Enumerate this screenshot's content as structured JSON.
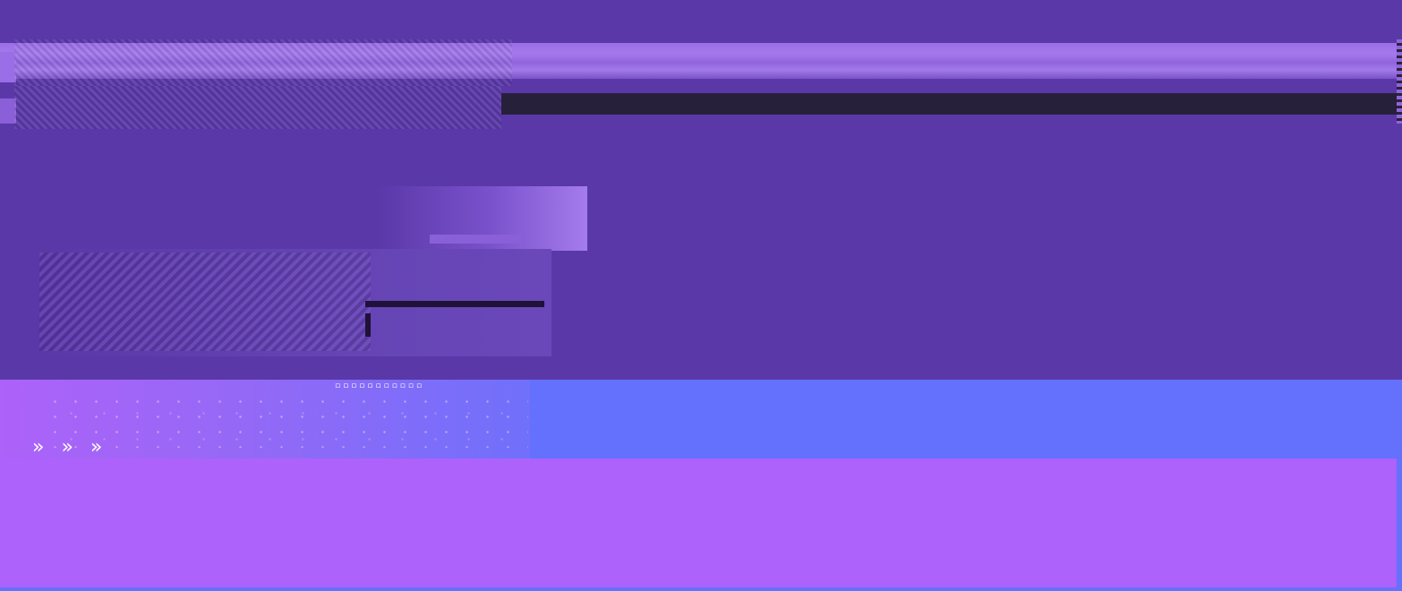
{
  "page": {
    "background": "#5a38a8"
  },
  "header": {
    "line1": "",
    "line2": ""
  },
  "logo": {
    "text": ""
  },
  "decor": {
    "dots": "▫▫▫▫▫▫▫▫▫▫▫",
    "chevrons": "» » »",
    "chevron_icon": "double-chevron-right-icon"
  },
  "colors": {
    "primary_purple": "#5a38a8",
    "light_purple": "#a579ec",
    "blue": "#6371fd",
    "violet": "#ad62fb",
    "dark": "#27203a"
  }
}
